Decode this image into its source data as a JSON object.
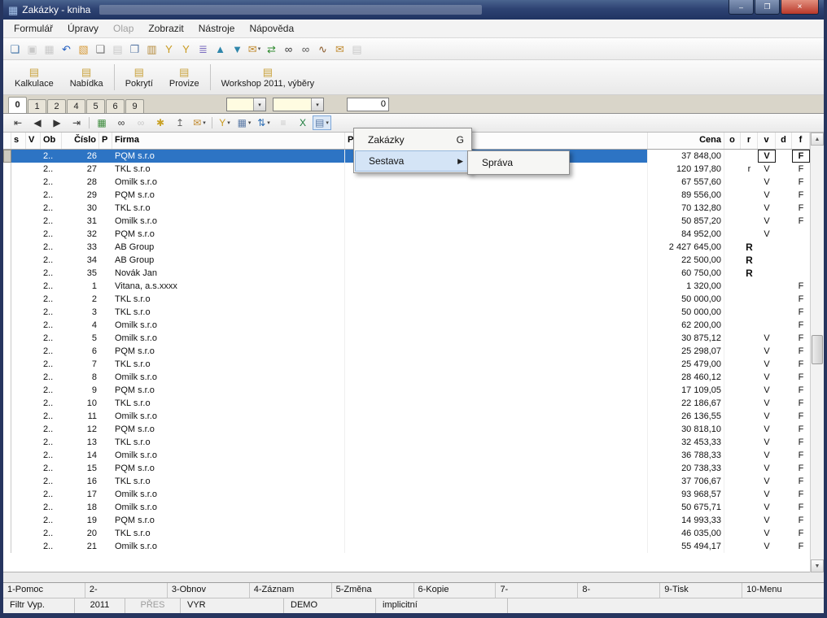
{
  "window": {
    "title": "Zakázky - kniha"
  },
  "titlebar": {
    "minimize_label": "–",
    "maximize_label": "❐",
    "close_label": "×"
  },
  "menubar": {
    "items": [
      {
        "label": "Formulář"
      },
      {
        "label": "Úpravy"
      },
      {
        "label": "Olap",
        "disabled": true
      },
      {
        "label": "Zobrazit"
      },
      {
        "label": "Nástroje"
      },
      {
        "label": "Nápověda"
      }
    ]
  },
  "toolbar_main": {
    "icons": [
      {
        "name": "form-switch-icon",
        "glyph": "❏",
        "color": "#3a6ea5"
      },
      {
        "name": "save-icon",
        "glyph": "▣",
        "color": "#8a8a8a",
        "disabled": true
      },
      {
        "name": "save-close-icon",
        "glyph": "▦",
        "color": "#8a8a8a",
        "disabled": true
      },
      {
        "name": "undo-icon",
        "glyph": "↶",
        "color": "#1f5bbf"
      },
      {
        "name": "open-folder-icon",
        "glyph": "▧",
        "color": "#d79b3a"
      },
      {
        "name": "new-document-icon",
        "glyph": "❑",
        "color": "#6f6f6f"
      },
      {
        "name": "print-preview-icon",
        "glyph": "▤",
        "color": "#8a8a8a",
        "disabled": true
      },
      {
        "name": "copy-icon",
        "glyph": "❐",
        "color": "#5b7aa6"
      },
      {
        "name": "paste-icon",
        "glyph": "▥",
        "color": "#b58a3a"
      },
      {
        "name": "filter-icon",
        "glyph": "Y",
        "color": "#c99a1f"
      },
      {
        "name": "filter-edit-icon",
        "glyph": "Y",
        "color": "#c99a1f"
      },
      {
        "name": "layers-icon",
        "glyph": "≣",
        "color": "#7a6bbf"
      },
      {
        "name": "move-up-icon",
        "glyph": "▲",
        "color": "#2e86ab"
      },
      {
        "name": "move-down-icon",
        "glyph": "▼",
        "color": "#2e86ab"
      },
      {
        "name": "send-mail-icon",
        "glyph": "✉",
        "color": "#c08a2f",
        "dropdown": true
      },
      {
        "name": "sync-icon",
        "glyph": "⇄",
        "color": "#2f8a2f"
      },
      {
        "name": "find-icon",
        "glyph": "∞",
        "color": "#333333"
      },
      {
        "name": "find-next-icon",
        "glyph": "∞",
        "color": "#555555"
      },
      {
        "name": "dog-icon",
        "glyph": "∿",
        "color": "#8a5a2a"
      },
      {
        "name": "mail-icon",
        "glyph": "✉",
        "color": "#c08a2f"
      },
      {
        "name": "report-icon",
        "glyph": "▤",
        "color": "#8a8a8a",
        "disabled": true
      }
    ]
  },
  "action_buttons": {
    "icon_glyph": "▤",
    "items": [
      {
        "label": "Kalkulace"
      },
      {
        "label": "Nabídka",
        "sep_after": true
      },
      {
        "label": "Pokrytí"
      },
      {
        "label": "Provize",
        "sep_after": true
      },
      {
        "label": "Workshop 2011, výběry"
      }
    ]
  },
  "tab_strip": {
    "tabs": [
      {
        "label": "0",
        "active": true
      },
      {
        "label": "1"
      },
      {
        "label": "2"
      },
      {
        "label": "4"
      },
      {
        "label": "5"
      },
      {
        "label": "6"
      },
      {
        "label": "9"
      }
    ],
    "filter_combo_1": {
      "value": ""
    },
    "filter_combo_2": {
      "value": ""
    },
    "record_count": "0"
  },
  "nav_toolbar": {
    "icons": [
      {
        "name": "first-record-icon",
        "glyph": "⇤",
        "color": "#333333"
      },
      {
        "name": "prev-record-icon",
        "glyph": "◀",
        "color": "#333333"
      },
      {
        "name": "next-record-icon",
        "glyph": "▶",
        "color": "#333333"
      },
      {
        "name": "last-record-icon",
        "glyph": "⇥",
        "color": "#333333"
      },
      {
        "sep": true
      },
      {
        "name": "refresh-grid-icon",
        "glyph": "▦",
        "color": "#3a8a3a"
      },
      {
        "name": "find-icon",
        "glyph": "∞",
        "color": "#333333"
      },
      {
        "name": "find-next-icon",
        "glyph": "∞",
        "color": "#888888",
        "disabled": true
      },
      {
        "name": "bookmark-add-icon",
        "glyph": "✱",
        "color": "#c9a227"
      },
      {
        "name": "copy-row-icon",
        "glyph": "↥",
        "color": "#666666"
      },
      {
        "name": "send-mail-icon",
        "glyph": "✉",
        "color": "#c08a2f",
        "dropdown": true
      },
      {
        "sep": true
      },
      {
        "name": "filter-menu-icon",
        "glyph": "Y",
        "color": "#c99a1f",
        "dropdown": true
      },
      {
        "name": "columns-menu-icon",
        "glyph": "▦",
        "color": "#5b7aa6",
        "dropdown": true
      },
      {
        "name": "sort-menu-icon",
        "glyph": "⇅",
        "color": "#2e6eb5",
        "dropdown": true
      },
      {
        "name": "list-settings-icon",
        "glyph": "≡",
        "color": "#8a8a8a",
        "disabled": true
      },
      {
        "name": "excel-export-icon",
        "glyph": "X",
        "color": "#1a7a3a"
      },
      {
        "name": "reports-menu-icon",
        "glyph": "▤",
        "color": "#5b7aa6",
        "dropdown": true,
        "pressed": true
      }
    ]
  },
  "table": {
    "columns": [
      {
        "key": "gutter",
        "label": "",
        "align": "left"
      },
      {
        "key": "s",
        "label": "s",
        "align": "left"
      },
      {
        "key": "v1",
        "label": "V",
        "align": "left"
      },
      {
        "key": "ob",
        "label": "Ob",
        "align": "left"
      },
      {
        "key": "cislo",
        "label": "Číslo",
        "align": "right"
      },
      {
        "key": "p",
        "label": "P",
        "align": "left"
      },
      {
        "key": "firma",
        "label": "Firma",
        "align": "left"
      },
      {
        "key": "po",
        "label": "Po",
        "align": "left"
      },
      {
        "key": "cena",
        "label": "Cena",
        "align": "right"
      },
      {
        "key": "o",
        "label": "o",
        "align": "center"
      },
      {
        "key": "r",
        "label": "r",
        "align": "center"
      },
      {
        "key": "v",
        "label": "v",
        "align": "center"
      },
      {
        "key": "d",
        "label": "d",
        "align": "center"
      },
      {
        "key": "f",
        "label": "f",
        "align": "center"
      }
    ],
    "rows": [
      {
        "ob": "2..",
        "cislo": "26",
        "firma": "PQM s.r.o",
        "cena": "37 848,00",
        "r": "",
        "v": "V",
        "f": "F",
        "selected": true
      },
      {
        "ob": "2..",
        "cislo": "27",
        "firma": "TKL s.r.o",
        "cena": "120 197,80",
        "r": "r",
        "v": "V",
        "f": "F"
      },
      {
        "ob": "2..",
        "cislo": "28",
        "firma": "Omilk s.r.o",
        "cena": "67 557,60",
        "v": "V",
        "f": "F"
      },
      {
        "ob": "2..",
        "cislo": "29",
        "firma": "PQM s.r.o",
        "cena": "89 556,00",
        "v": "V",
        "f": "F"
      },
      {
        "ob": "2..",
        "cislo": "30",
        "firma": "TKL s.r.o",
        "cena": "70 132,80",
        "v": "V",
        "f": "F"
      },
      {
        "ob": "2..",
        "cislo": "31",
        "firma": "Omilk s.r.o",
        "cena": "50 857,20",
        "v": "V",
        "f": "F"
      },
      {
        "ob": "2..",
        "cislo": "32",
        "firma": "PQM s.r.o",
        "cena": "84 952,00",
        "v": "V",
        "f": ""
      },
      {
        "ob": "2..",
        "cislo": "33",
        "firma": "AB Group",
        "cena": "2 427 645,00",
        "r": "R"
      },
      {
        "ob": "2..",
        "cislo": "34",
        "firma": "AB Group",
        "cena": "22 500,00",
        "r": "R"
      },
      {
        "ob": "2..",
        "cislo": "35",
        "firma": "Novák Jan",
        "cena": "60 750,00",
        "r": "R"
      },
      {
        "ob": "2..",
        "cislo": "1",
        "firma": "Vitana, a.s.xxxx",
        "cena": "1 320,00",
        "f": "F"
      },
      {
        "ob": "2..",
        "cislo": "2",
        "firma": "TKL s.r.o",
        "cena": "50 000,00",
        "f": "F"
      },
      {
        "ob": "2..",
        "cislo": "3",
        "firma": "TKL s.r.o",
        "cena": "50 000,00",
        "f": "F"
      },
      {
        "ob": "2..",
        "cislo": "4",
        "firma": "Omilk s.r.o",
        "cena": "62 200,00",
        "f": "F"
      },
      {
        "ob": "2..",
        "cislo": "5",
        "firma": "Omilk s.r.o",
        "cena": "30 875,12",
        "v": "V",
        "f": "F"
      },
      {
        "ob": "2..",
        "cislo": "6",
        "firma": "PQM s.r.o",
        "cena": "25 298,07",
        "v": "V",
        "f": "F"
      },
      {
        "ob": "2..",
        "cislo": "7",
        "firma": "TKL s.r.o",
        "cena": "25 479,00",
        "v": "V",
        "f": "F"
      },
      {
        "ob": "2..",
        "cislo": "8",
        "firma": "Omilk s.r.o",
        "cena": "28 460,12",
        "v": "V",
        "f": "F"
      },
      {
        "ob": "2..",
        "cislo": "9",
        "firma": "PQM s.r.o",
        "cena": "17 109,05",
        "v": "V",
        "f": "F"
      },
      {
        "ob": "2..",
        "cislo": "10",
        "firma": "TKL s.r.o",
        "cena": "22 186,67",
        "v": "V",
        "f": "F"
      },
      {
        "ob": "2..",
        "cislo": "11",
        "firma": "Omilk s.r.o",
        "cena": "26 136,55",
        "v": "V",
        "f": "F"
      },
      {
        "ob": "2..",
        "cislo": "12",
        "firma": "PQM s.r.o",
        "cena": "30 818,10",
        "v": "V",
        "f": "F"
      },
      {
        "ob": "2..",
        "cislo": "13",
        "firma": "TKL s.r.o",
        "cena": "32 453,33",
        "v": "V",
        "f": "F"
      },
      {
        "ob": "2..",
        "cislo": "14",
        "firma": "Omilk s.r.o",
        "cena": "36 788,33",
        "v": "V",
        "f": "F"
      },
      {
        "ob": "2..",
        "cislo": "15",
        "firma": "PQM s.r.o",
        "cena": "20 738,33",
        "v": "V",
        "f": "F"
      },
      {
        "ob": "2..",
        "cislo": "16",
        "firma": "TKL s.r.o",
        "cena": "37 706,67",
        "v": "V",
        "f": "F"
      },
      {
        "ob": "2..",
        "cislo": "17",
        "firma": "Omilk s.r.o",
        "cena": "93 968,57",
        "v": "V",
        "f": "F"
      },
      {
        "ob": "2..",
        "cislo": "18",
        "firma": "Omilk s.r.o",
        "cena": "50 675,71",
        "v": "V",
        "f": "F"
      },
      {
        "ob": "2..",
        "cislo": "19",
        "firma": "PQM s.r.o",
        "cena": "14 993,33",
        "v": "V",
        "f": "F"
      },
      {
        "ob": "2..",
        "cislo": "20",
        "firma": "TKL s.r.o",
        "cena": "46 035,00",
        "v": "V",
        "f": "F"
      },
      {
        "ob": "2..",
        "cislo": "21",
        "firma": "Omilk s.r.o",
        "cena": "55 494,17",
        "v": "V",
        "f": "F"
      }
    ]
  },
  "context_menu": {
    "items": [
      {
        "label": "Zakázky",
        "shortcut": "G"
      },
      {
        "label": "Sestava",
        "submenu": true,
        "selected": true
      }
    ],
    "submenu_items": [
      {
        "label": "Správa"
      }
    ]
  },
  "function_keys": {
    "items": [
      "1-Pomoc",
      "2-",
      "3-Obnov",
      "4-Záznam",
      "5-Změna",
      "6-Kopie",
      "7-",
      "8-",
      "9-Tisk",
      "10-Menu"
    ]
  },
  "statusbar": {
    "items": [
      {
        "label": "Filtr Vyp."
      },
      {
        "label": "2011"
      },
      {
        "label": "PŘES",
        "disabled": true
      },
      {
        "label": "VYR"
      },
      {
        "label": "DEMO"
      },
      {
        "label": "implicitní"
      }
    ]
  },
  "colors": {
    "selection": "#2d74c4",
    "titlebar": "#2c4170",
    "close_button": "#b9382a",
    "combo_background": "#fffce1"
  }
}
